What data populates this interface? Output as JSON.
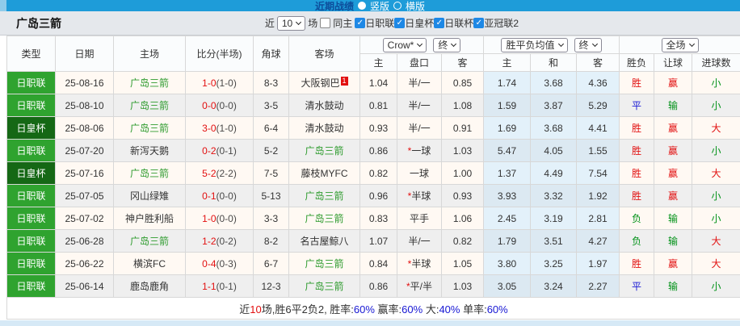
{
  "titlebar": {
    "title": "近期战绩",
    "radio_selected_label": "竖版",
    "radio_unselected_label": "横版"
  },
  "controls": {
    "team": "广岛三箭",
    "near_label": "近",
    "games_value": "10",
    "games_suffix": "场",
    "same_home_label": "同主",
    "leagues": [
      "日职联",
      "日皇杯",
      "日联杯",
      "亚冠联2"
    ]
  },
  "table": {
    "main_headers": [
      "类型",
      "日期",
      "主场",
      "比分(半场)",
      "角球",
      "客场"
    ],
    "odds_groups": [
      {
        "select": "Crow*",
        "select2": "终",
        "cols": [
          "主",
          "盘口",
          "客"
        ]
      },
      {
        "select": "胜平负均值",
        "select2": "终",
        "cols": [
          "主",
          "和",
          "客"
        ]
      },
      {
        "select": "全场",
        "cols": [
          "胜负",
          "让球",
          "进球数"
        ]
      }
    ],
    "rows": [
      {
        "comp": "日职联",
        "comp_type": "jl",
        "date": "25-08-16",
        "home": "广岛三箭",
        "home_focus": true,
        "score": "1-0",
        "half": "(1-0)",
        "corner": "8-3",
        "away": "大阪钢巴",
        "away_focus": false,
        "away_sup": "1",
        "asian_home": "1.04",
        "handicap": "半/一",
        "handicap_star": false,
        "asian_away": "0.85",
        "avg_home": "1.74",
        "avg_draw": "3.68",
        "avg_away": "4.36",
        "result": [
          "胜",
          "r"
        ],
        "handicap_result": [
          "赢",
          "r"
        ],
        "goals_result": [
          "小",
          "g"
        ]
      },
      {
        "comp": "日职联",
        "comp_type": "jl",
        "date": "25-08-10",
        "home": "广岛三箭",
        "home_focus": true,
        "score": "0-0",
        "half": "(0-0)",
        "corner": "3-5",
        "away": "清水鼓动",
        "away_focus": false,
        "away_sup": null,
        "asian_home": "0.81",
        "handicap": "半/一",
        "handicap_star": false,
        "asian_away": "1.08",
        "avg_home": "1.59",
        "avg_draw": "3.87",
        "avg_away": "5.29",
        "result": [
          "平",
          "b"
        ],
        "handicap_result": [
          "输",
          "g"
        ],
        "goals_result": [
          "小",
          "g"
        ]
      },
      {
        "comp": "日皇杯",
        "comp_type": "ec",
        "date": "25-08-06",
        "home": "广岛三箭",
        "home_focus": true,
        "score": "3-0",
        "half": "(1-0)",
        "corner": "6-4",
        "away": "清水鼓动",
        "away_focus": false,
        "away_sup": null,
        "asian_home": "0.93",
        "handicap": "半/一",
        "handicap_star": false,
        "asian_away": "0.91",
        "avg_home": "1.69",
        "avg_draw": "3.68",
        "avg_away": "4.41",
        "result": [
          "胜",
          "r"
        ],
        "handicap_result": [
          "赢",
          "r"
        ],
        "goals_result": [
          "大",
          "r"
        ]
      },
      {
        "comp": "日职联",
        "comp_type": "jl",
        "date": "25-07-20",
        "home": "新泻天鹅",
        "home_focus": false,
        "score": "0-2",
        "half": "(0-1)",
        "corner": "5-2",
        "away": "广岛三箭",
        "away_focus": true,
        "away_sup": null,
        "asian_home": "0.86",
        "handicap": "一球",
        "handicap_star": true,
        "asian_away": "1.03",
        "avg_home": "5.47",
        "avg_draw": "4.05",
        "avg_away": "1.55",
        "result": [
          "胜",
          "r"
        ],
        "handicap_result": [
          "赢",
          "r"
        ],
        "goals_result": [
          "小",
          "g"
        ]
      },
      {
        "comp": "日皇杯",
        "comp_type": "ec",
        "date": "25-07-16",
        "home": "广岛三箭",
        "home_focus": true,
        "score": "5-2",
        "half": "(2-2)",
        "corner": "7-5",
        "away": "藤枝MYFC",
        "away_focus": false,
        "away_sup": null,
        "asian_home": "0.82",
        "handicap": "一球",
        "handicap_star": false,
        "asian_away": "1.00",
        "avg_home": "1.37",
        "avg_draw": "4.49",
        "avg_away": "7.54",
        "result": [
          "胜",
          "r"
        ],
        "handicap_result": [
          "赢",
          "r"
        ],
        "goals_result": [
          "大",
          "r"
        ]
      },
      {
        "comp": "日职联",
        "comp_type": "jl",
        "date": "25-07-05",
        "home": "冈山绿雉",
        "home_focus": false,
        "score": "0-1",
        "half": "(0-0)",
        "corner": "5-13",
        "away": "广岛三箭",
        "away_focus": true,
        "away_sup": null,
        "asian_home": "0.96",
        "handicap": "半球",
        "handicap_star": true,
        "asian_away": "0.93",
        "avg_home": "3.93",
        "avg_draw": "3.32",
        "avg_away": "1.92",
        "result": [
          "胜",
          "r"
        ],
        "handicap_result": [
          "赢",
          "r"
        ],
        "goals_result": [
          "小",
          "g"
        ]
      },
      {
        "comp": "日职联",
        "comp_type": "jl",
        "date": "25-07-02",
        "home": "神户胜利船",
        "home_focus": false,
        "score": "1-0",
        "half": "(0-0)",
        "corner": "3-3",
        "away": "广岛三箭",
        "away_focus": true,
        "away_sup": null,
        "asian_home": "0.83",
        "handicap": "平手",
        "handicap_star": false,
        "asian_away": "1.06",
        "avg_home": "2.45",
        "avg_draw": "3.19",
        "avg_away": "2.81",
        "result": [
          "负",
          "g"
        ],
        "handicap_result": [
          "输",
          "g"
        ],
        "goals_result": [
          "小",
          "g"
        ]
      },
      {
        "comp": "日职联",
        "comp_type": "jl",
        "date": "25-06-28",
        "home": "广岛三箭",
        "home_focus": true,
        "score": "1-2",
        "half": "(0-2)",
        "corner": "8-2",
        "away": "名古屋鲸八",
        "away_focus": false,
        "away_sup": null,
        "asian_home": "1.07",
        "handicap": "半/一",
        "handicap_star": false,
        "asian_away": "0.82",
        "avg_home": "1.79",
        "avg_draw": "3.51",
        "avg_away": "4.27",
        "result": [
          "负",
          "g"
        ],
        "handicap_result": [
          "输",
          "g"
        ],
        "goals_result": [
          "大",
          "r"
        ]
      },
      {
        "comp": "日职联",
        "comp_type": "jl",
        "date": "25-06-22",
        "home": "横滨FC",
        "home_focus": false,
        "score": "0-4",
        "half": "(0-3)",
        "corner": "6-7",
        "away": "广岛三箭",
        "away_focus": true,
        "away_sup": null,
        "asian_home": "0.84",
        "handicap": "半球",
        "handicap_star": true,
        "asian_away": "1.05",
        "avg_home": "3.80",
        "avg_draw": "3.25",
        "avg_away": "1.97",
        "result": [
          "胜",
          "r"
        ],
        "handicap_result": [
          "赢",
          "r"
        ],
        "goals_result": [
          "大",
          "r"
        ]
      },
      {
        "comp": "日职联",
        "comp_type": "jl",
        "date": "25-06-14",
        "home": "鹿岛鹿角",
        "home_focus": false,
        "score": "1-1",
        "half": "(0-1)",
        "corner": "12-3",
        "away": "广岛三箭",
        "away_focus": true,
        "away_sup": null,
        "asian_home": "0.86",
        "handicap": "平/半",
        "handicap_star": true,
        "asian_away": "1.03",
        "avg_home": "3.05",
        "avg_draw": "3.24",
        "avg_away": "2.27",
        "result": [
          "平",
          "b"
        ],
        "handicap_result": [
          "输",
          "g"
        ],
        "goals_result": [
          "小",
          "g"
        ]
      }
    ]
  },
  "footer": {
    "segments": [
      {
        "t": "近",
        "c": "k"
      },
      {
        "t": "10",
        "c": "r"
      },
      {
        "t": "场,胜6平2负2, 胜率:",
        "c": "k"
      },
      {
        "t": "60%",
        "c": "b"
      },
      {
        "t": " 赢率:",
        "c": "k"
      },
      {
        "t": "60%",
        "c": "b"
      },
      {
        "t": " 大:",
        "c": "k"
      },
      {
        "t": "40%",
        "c": "b"
      },
      {
        "t": " 单率:",
        "c": "k"
      },
      {
        "t": "60%",
        "c": "b"
      }
    ]
  },
  "colors": {
    "topbar_blue": "#1E9CD9",
    "league_green": "#2FA32F",
    "cup_dark_green": "#156815",
    "focus_team_green": "#2E9B2E",
    "score_red": "#E21010",
    "result_green": "#009117",
    "result_blue": "#1717D4",
    "avg_col_blue_bg": "#E3F1FA"
  }
}
